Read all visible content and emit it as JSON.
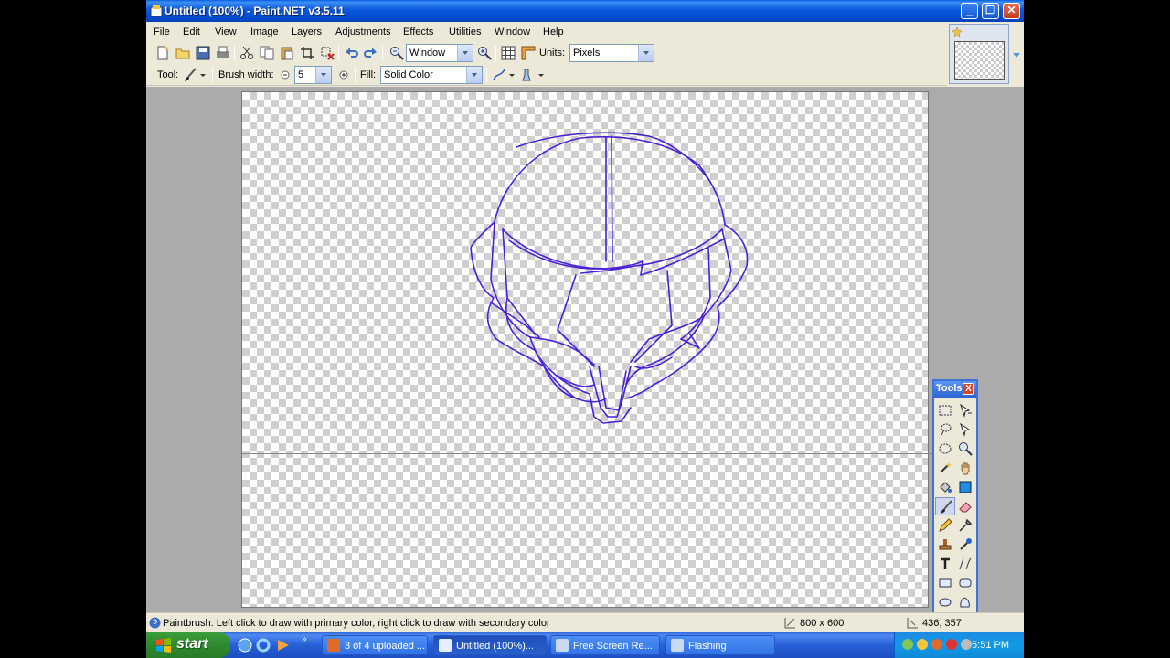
{
  "window": {
    "title": "Untitled (100%) - Paint.NET v3.5.11"
  },
  "menu": [
    "File",
    "Edit",
    "View",
    "Image",
    "Layers",
    "Adjustments",
    "Effects",
    "Utilities",
    "Window",
    "Help"
  ],
  "toolbar": {
    "zoom_value": "Window",
    "units_label": "Units:",
    "units_value": "Pixels",
    "tool_label": "Tool:",
    "brush_width_label": "Brush width:",
    "brush_width_value": "5",
    "fill_label": "Fill:",
    "fill_value": "Solid Color"
  },
  "tools_window": {
    "title": "Tools",
    "close": "X"
  },
  "status": {
    "help_text": "Paintbrush: Left click to draw with primary color, right click to draw with secondary color",
    "image_size": "800 x 600",
    "cursor_position": "436, 357"
  },
  "taskbar": {
    "start_label": "start",
    "tasks": [
      "3 of 4 uploaded ...",
      "Untitled (100%)...",
      "Free Screen Re...",
      "Flashing"
    ],
    "clock": "5:51 PM"
  },
  "colors": {
    "primary_brush": "#4a1fd8",
    "titlebar": "#0a58dd",
    "start_button": "#2d8a2d"
  },
  "icons": [
    "new-icon",
    "open-icon",
    "save-icon",
    "print-icon",
    "cut-icon",
    "copy-icon",
    "paste-icon",
    "crop-icon",
    "deselect-icon",
    "undo-icon",
    "redo-icon",
    "zoom-out-icon",
    "zoom-in-icon",
    "grid-icon",
    "ruler-icon"
  ]
}
